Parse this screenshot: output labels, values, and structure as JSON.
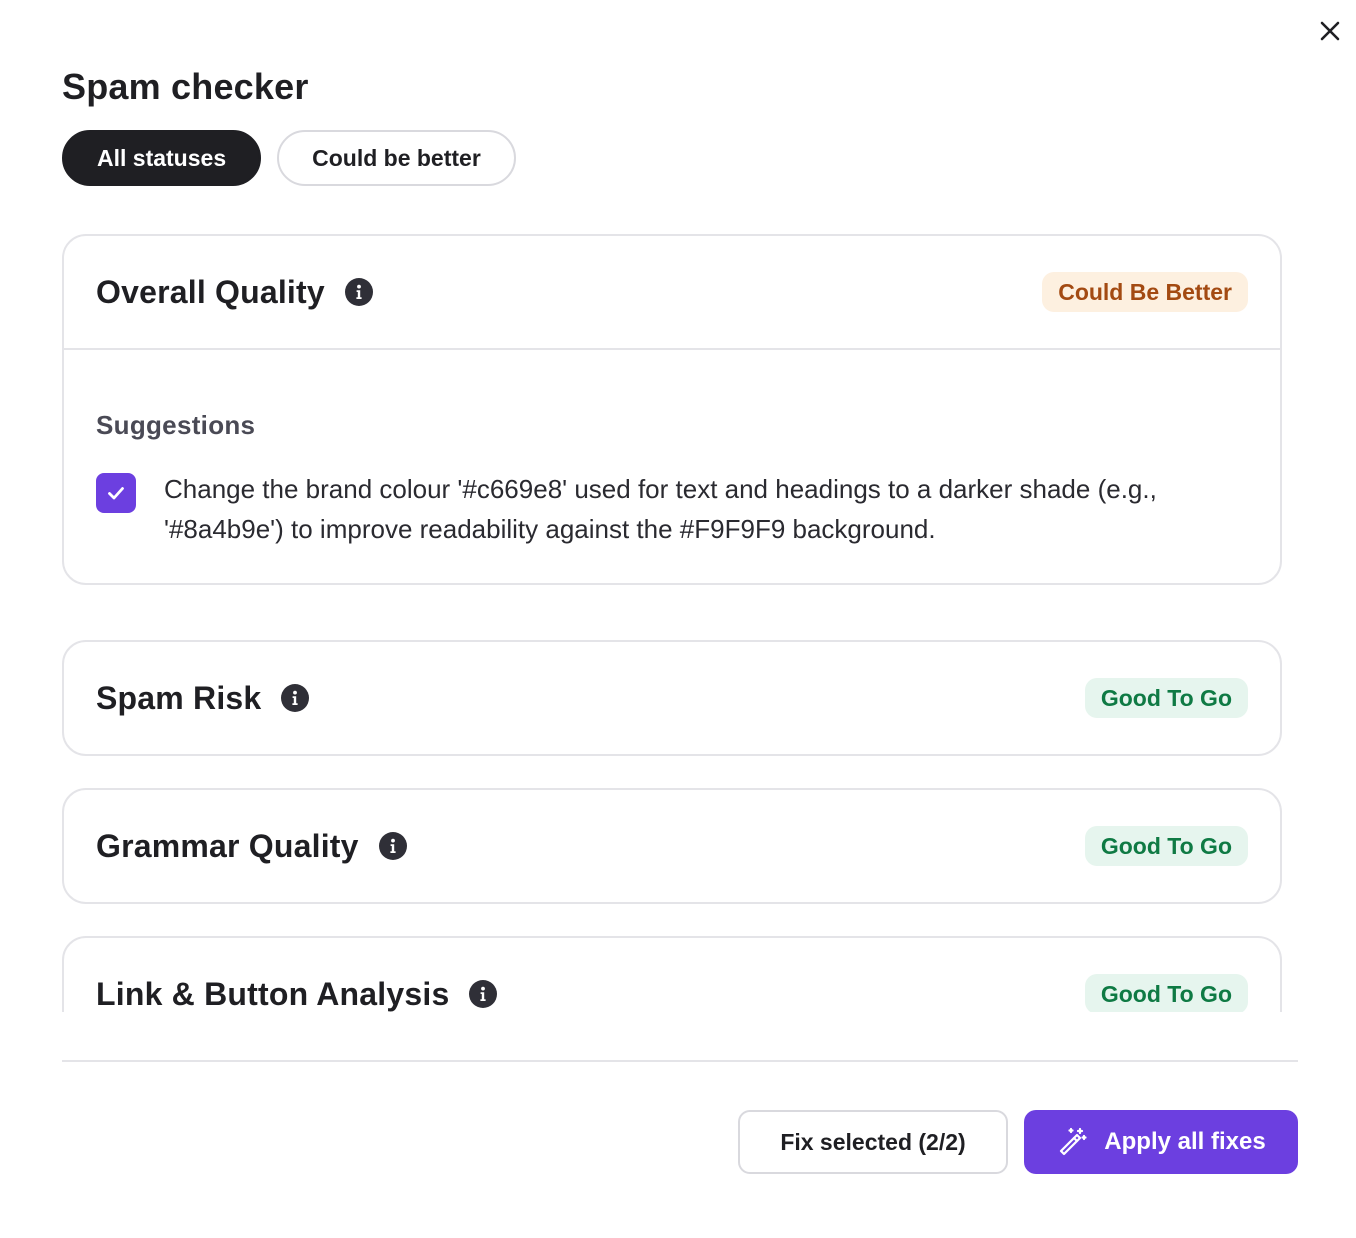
{
  "dialog": {
    "title": "Spam checker",
    "close_icon": "close-icon"
  },
  "filters": [
    {
      "label": "All statuses",
      "active": true
    },
    {
      "label": "Could be better",
      "active": false
    }
  ],
  "cards": [
    {
      "title": "Overall Quality",
      "status": "Could Be Better",
      "status_type": "warning",
      "suggestions_heading": "Suggestions",
      "suggestions": [
        {
          "checked": true,
          "text": "Change the brand colour '#c669e8' used for text and headings to a darker shade (e.g., '#8a4b9e') to improve readability against the #F9F9F9 background."
        }
      ]
    },
    {
      "title": "Spam Risk",
      "status": "Good To Go",
      "status_type": "good"
    },
    {
      "title": "Grammar Quality",
      "status": "Good To Go",
      "status_type": "good"
    },
    {
      "title": "Link & Button Analysis",
      "status": "Good To Go",
      "status_type": "good"
    }
  ],
  "footer": {
    "fix_selected_label": "Fix selected (2/2)",
    "apply_all_label": "Apply all fixes",
    "apply_all_icon": "magic-wand-icon"
  },
  "colors": {
    "accent": "#6c3fe0",
    "dark": "#1f1f23",
    "warning_bg": "#fdf0e0",
    "warning_text": "#a34a12",
    "good_bg": "#e6f5ee",
    "good_text": "#0f7a44"
  }
}
